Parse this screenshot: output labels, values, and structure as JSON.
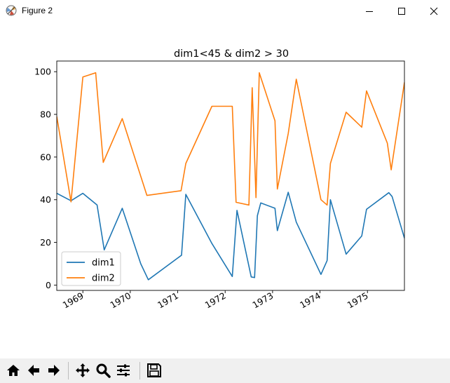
{
  "window": {
    "title": "Figure 2"
  },
  "chart_data": {
    "type": "line",
    "title": "dim1<45 & dim2 > 30",
    "xlabel": "",
    "ylabel": "",
    "x_ticks": [
      "1969",
      "1970",
      "1971",
      "1972",
      "1973",
      "1974",
      "1975"
    ],
    "y_ticks": [
      "0",
      "20",
      "40",
      "60",
      "80",
      "100"
    ],
    "ylim": [
      -2.5,
      105
    ],
    "xlim": [
      1968.45,
      1975.78
    ],
    "grid": false,
    "legend_position": "lower left",
    "series": [
      {
        "name": "dim1",
        "color": "#1f77b4",
        "x": [
          1968.45,
          1968.75,
          1969.0,
          1969.3,
          1969.45,
          1969.83,
          1970.22,
          1970.38,
          1971.08,
          1971.17,
          1971.72,
          1972.15,
          1972.25,
          1972.55,
          1972.62,
          1972.68,
          1972.75,
          1973.05,
          1973.1,
          1973.33,
          1973.5,
          1974.02,
          1974.15,
          1974.22,
          1974.55,
          1974.88,
          1974.98,
          1975.45,
          1975.52,
          1975.78
        ],
        "y": [
          43,
          39.5,
          43,
          37.5,
          16.5,
          36,
          10,
          2.5,
          14,
          42.5,
          19.5,
          4,
          35,
          3.8,
          3.5,
          32.5,
          38.5,
          36,
          25.5,
          43.5,
          29.5,
          5,
          11.5,
          40,
          14.5,
          23,
          35.5,
          43.3,
          41.5,
          22
        ]
      },
      {
        "name": "dim2",
        "color": "#ff7f0e",
        "x": [
          1968.45,
          1968.75,
          1969.0,
          1969.27,
          1969.43,
          1969.83,
          1970.35,
          1971.07,
          1971.17,
          1971.72,
          1972.15,
          1972.23,
          1972.5,
          1972.57,
          1972.65,
          1972.72,
          1973.05,
          1973.1,
          1973.33,
          1973.5,
          1974.02,
          1974.15,
          1974.22,
          1974.55,
          1974.88,
          1974.98,
          1975.42,
          1975.5,
          1975.78
        ],
        "y": [
          79,
          39,
          97.5,
          99.5,
          57.5,
          78,
          42,
          44.2,
          57,
          83.8,
          83.8,
          38.8,
          37.5,
          92.5,
          41,
          99.5,
          77,
          45,
          71,
          96.5,
          40,
          37.5,
          57,
          81,
          74,
          91,
          66.5,
          54,
          95
        ]
      }
    ]
  },
  "toolbar": {
    "buttons": [
      "home-icon",
      "back-icon",
      "forward-icon",
      "pan-icon",
      "zoom-icon",
      "configure-subplots-icon",
      "save-icon"
    ]
  }
}
